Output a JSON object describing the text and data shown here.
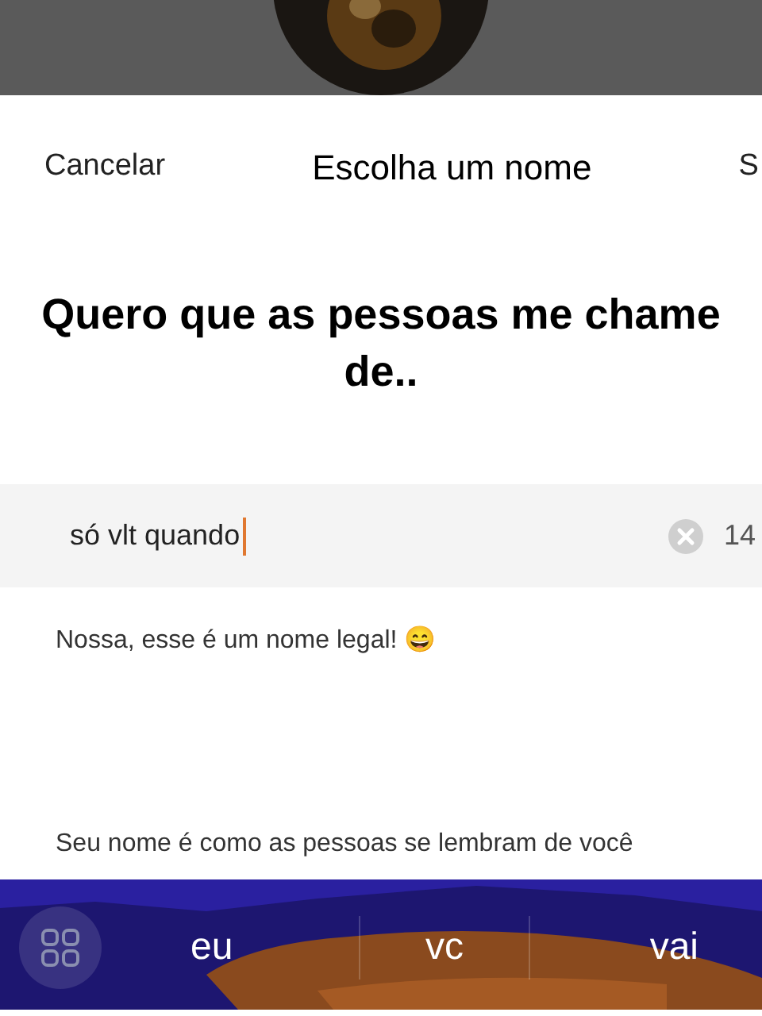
{
  "header": {
    "cancel": "Cancelar",
    "title": "Escolha um nome",
    "save": "S"
  },
  "heading": "Quero que as pessoas me chame de..",
  "name_field": {
    "value": "só vlt quando",
    "counter": "14",
    "focused": true
  },
  "feedback": "Nossa, esse é um nome legal! 😄",
  "helper": "Seu nome é como as pessoas se lembram de você",
  "keyboard": {
    "suggestions": [
      "eu",
      "vc",
      "vai"
    ]
  }
}
